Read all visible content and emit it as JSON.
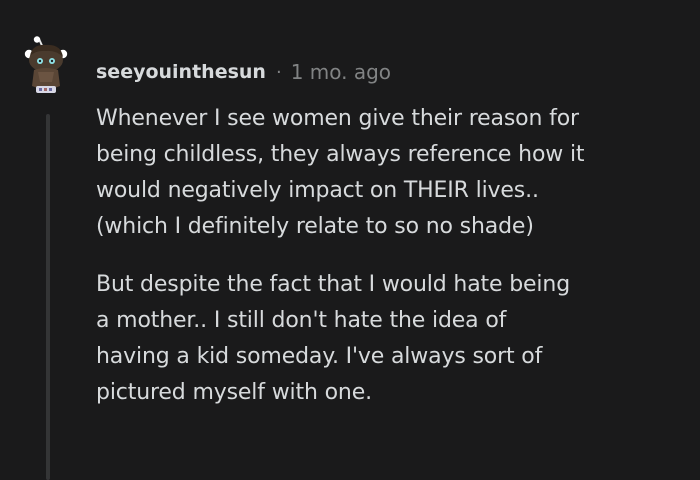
{
  "comment": {
    "author": "seeyouinthesun",
    "separator": "·",
    "timestamp": "1 mo. ago",
    "avatar_icon": "snoo-avatar-icon",
    "paragraphs": [
      [
        "Whenever I see women give their reason for",
        "being childless, they always reference how it",
        "would negatively impact on THEIR lives..",
        "(which I definitely relate to so no shade)"
      ],
      [
        "But despite the fact that I would hate being",
        "a mother.. I still don't hate the idea of",
        "having a kid someday. I've always sort of",
        "pictured myself with one."
      ]
    ]
  },
  "colors": {
    "background": "#1a1a1b",
    "text": "#d7dadc",
    "meta": "#818384",
    "thread_line": "#343536"
  }
}
